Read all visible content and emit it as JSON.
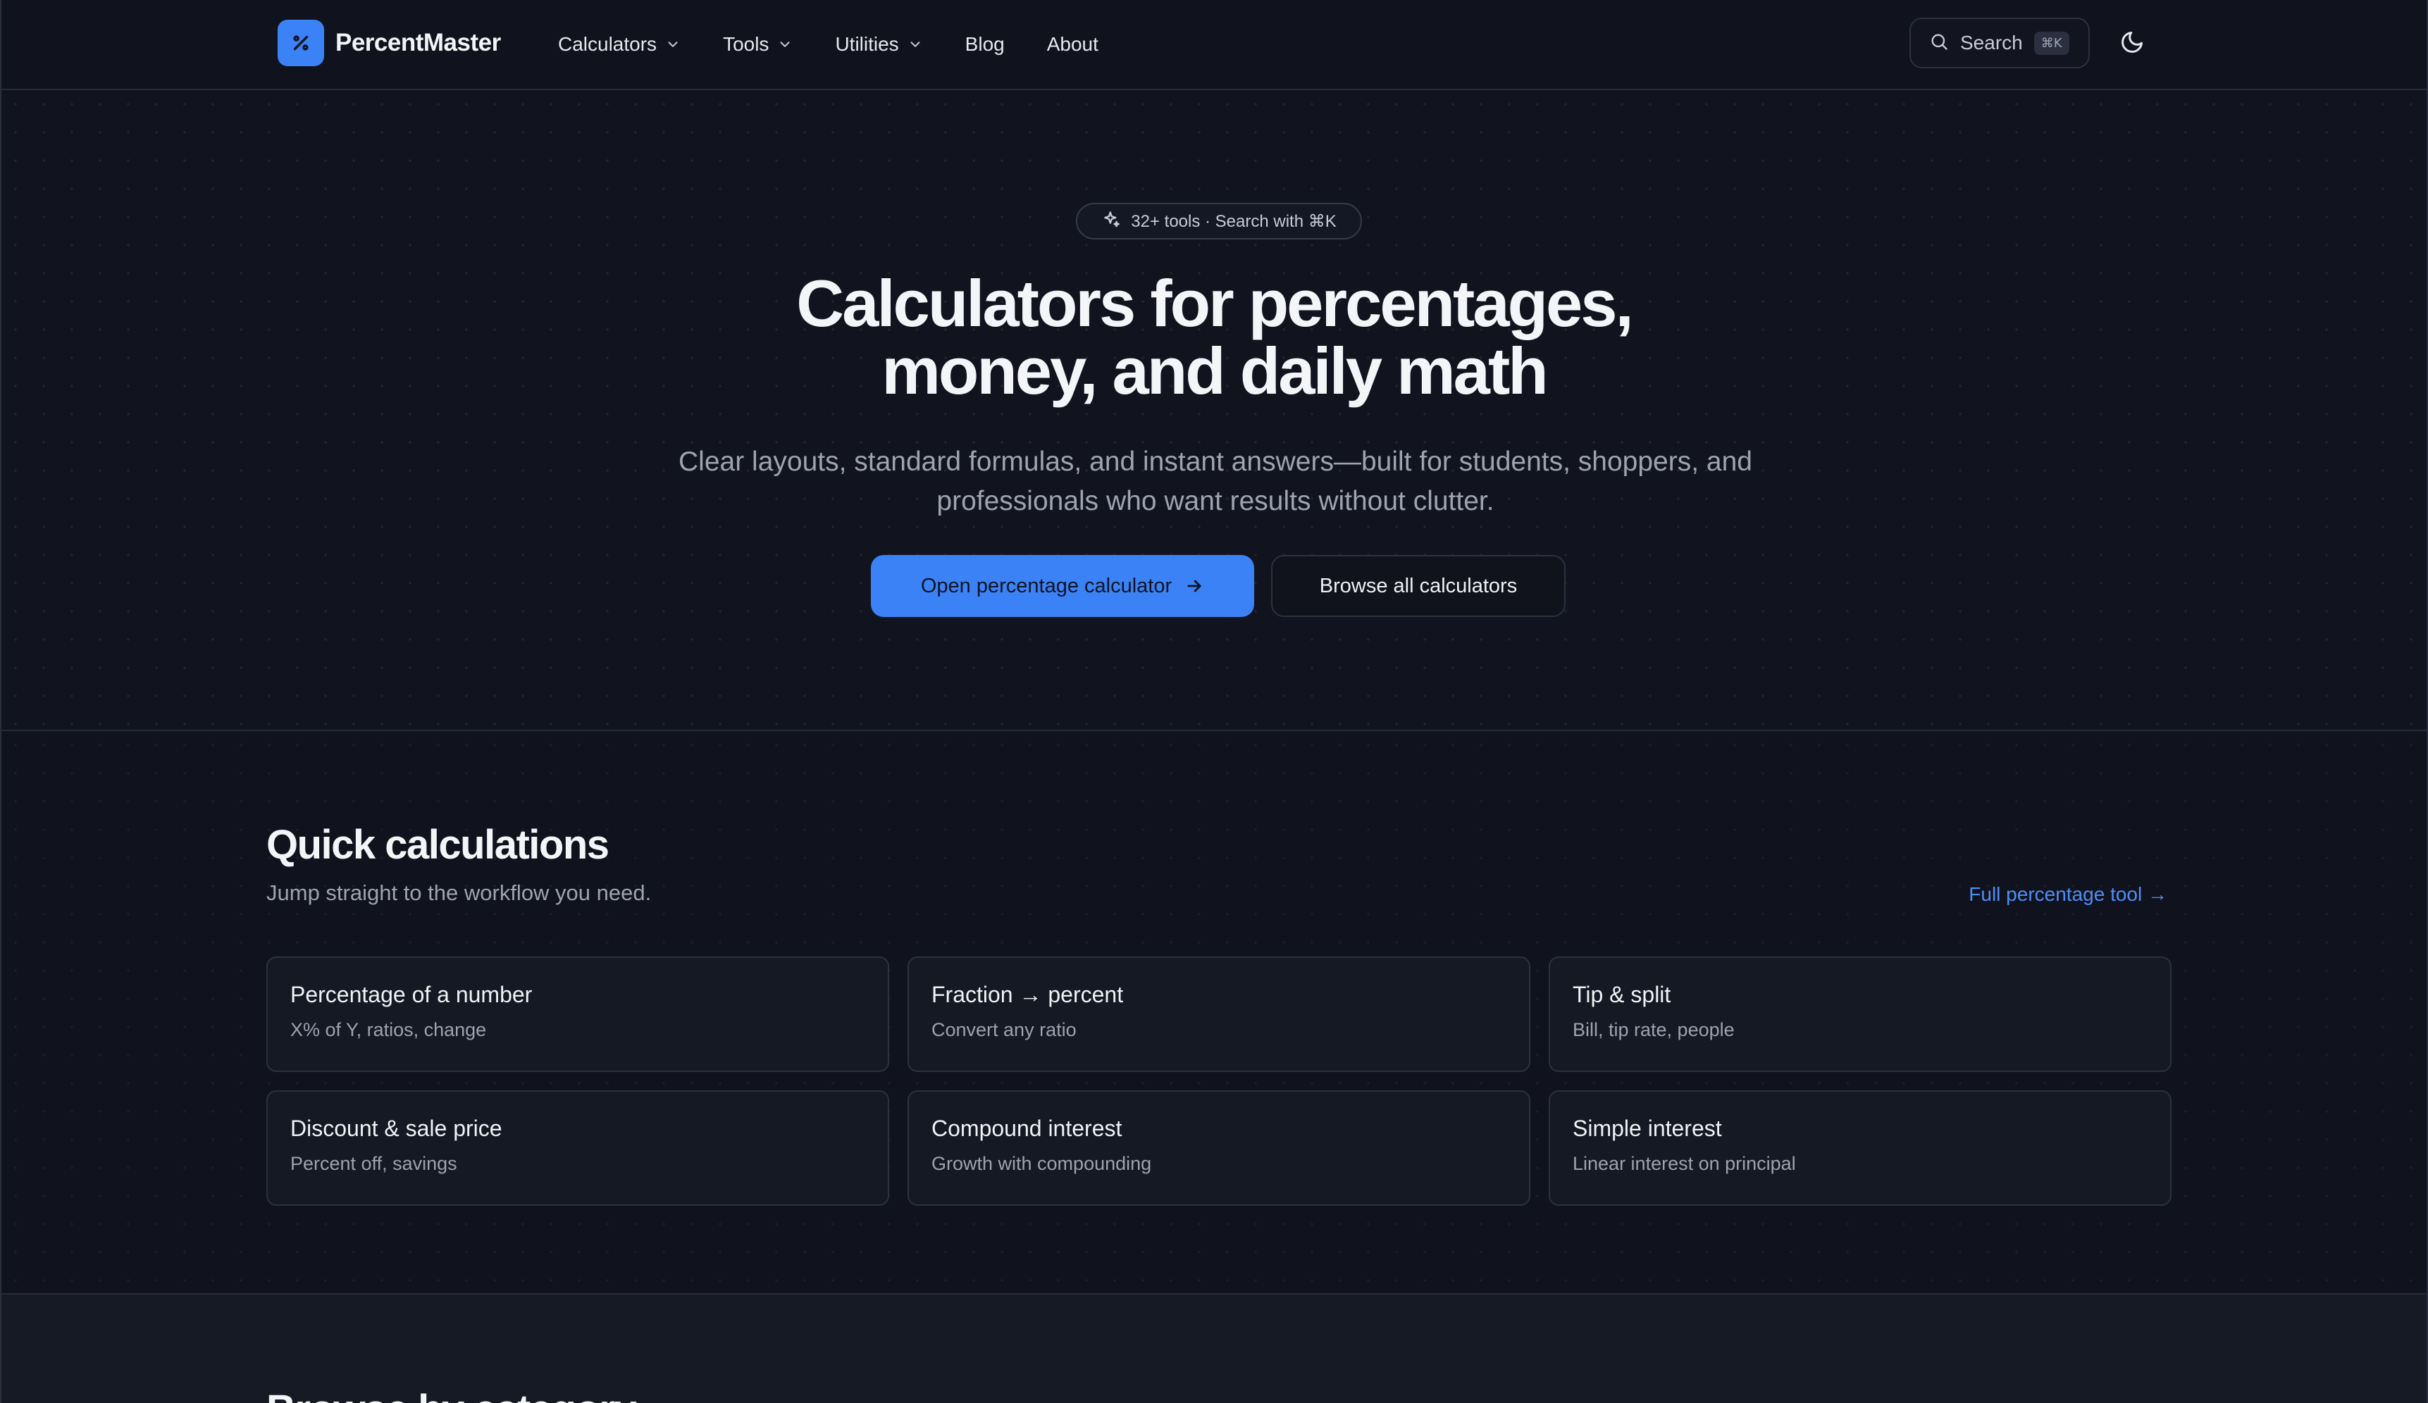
{
  "colors": {
    "background": "#10131d",
    "accent": "#3b82f6",
    "link": "#4f8ef7",
    "card_border": "#2c3140"
  },
  "nav": {
    "brand": "PercentMaster",
    "brand_icon": "percent-icon",
    "items": [
      {
        "label": "Calculators",
        "has_dropdown": true
      },
      {
        "label": "Tools",
        "has_dropdown": true
      },
      {
        "label": "Utilities",
        "has_dropdown": true
      },
      {
        "label": "Blog",
        "has_dropdown": false
      },
      {
        "label": "About",
        "has_dropdown": false
      }
    ],
    "search": {
      "label": "Search",
      "shortcut": "⌘K",
      "icon": "search-icon"
    },
    "theme_toggle_icon": "moon-icon"
  },
  "hero": {
    "badge": "32+ tools · Search with ⌘K",
    "badge_icon": "sparkle-icon",
    "title_line1": "Calculators for percentages,",
    "title_line2": "money, and daily math",
    "subtitle": "Clear layouts, standard formulas, and instant answers—built for students, shoppers, and professionals who want results without clutter.",
    "primary_cta": "Open percentage calculator",
    "secondary_cta": "Browse all calculators"
  },
  "quick": {
    "title": "Quick calculations",
    "subtitle": "Jump straight to the workflow you need.",
    "link": "Full percentage tool →",
    "cards": [
      {
        "title": "Percentage of a number",
        "desc": "X% of Y, ratios, change"
      },
      {
        "title": "Fraction → percent",
        "desc": "Convert any ratio"
      },
      {
        "title": "Tip & split",
        "desc": "Bill, tip rate, people"
      },
      {
        "title": "Discount & sale price",
        "desc": "Percent off, savings"
      },
      {
        "title": "Compound interest",
        "desc": "Growth with compounding"
      },
      {
        "title": "Simple interest",
        "desc": "Linear interest on principal"
      }
    ]
  },
  "next_section": {
    "title": "Browse by category"
  }
}
